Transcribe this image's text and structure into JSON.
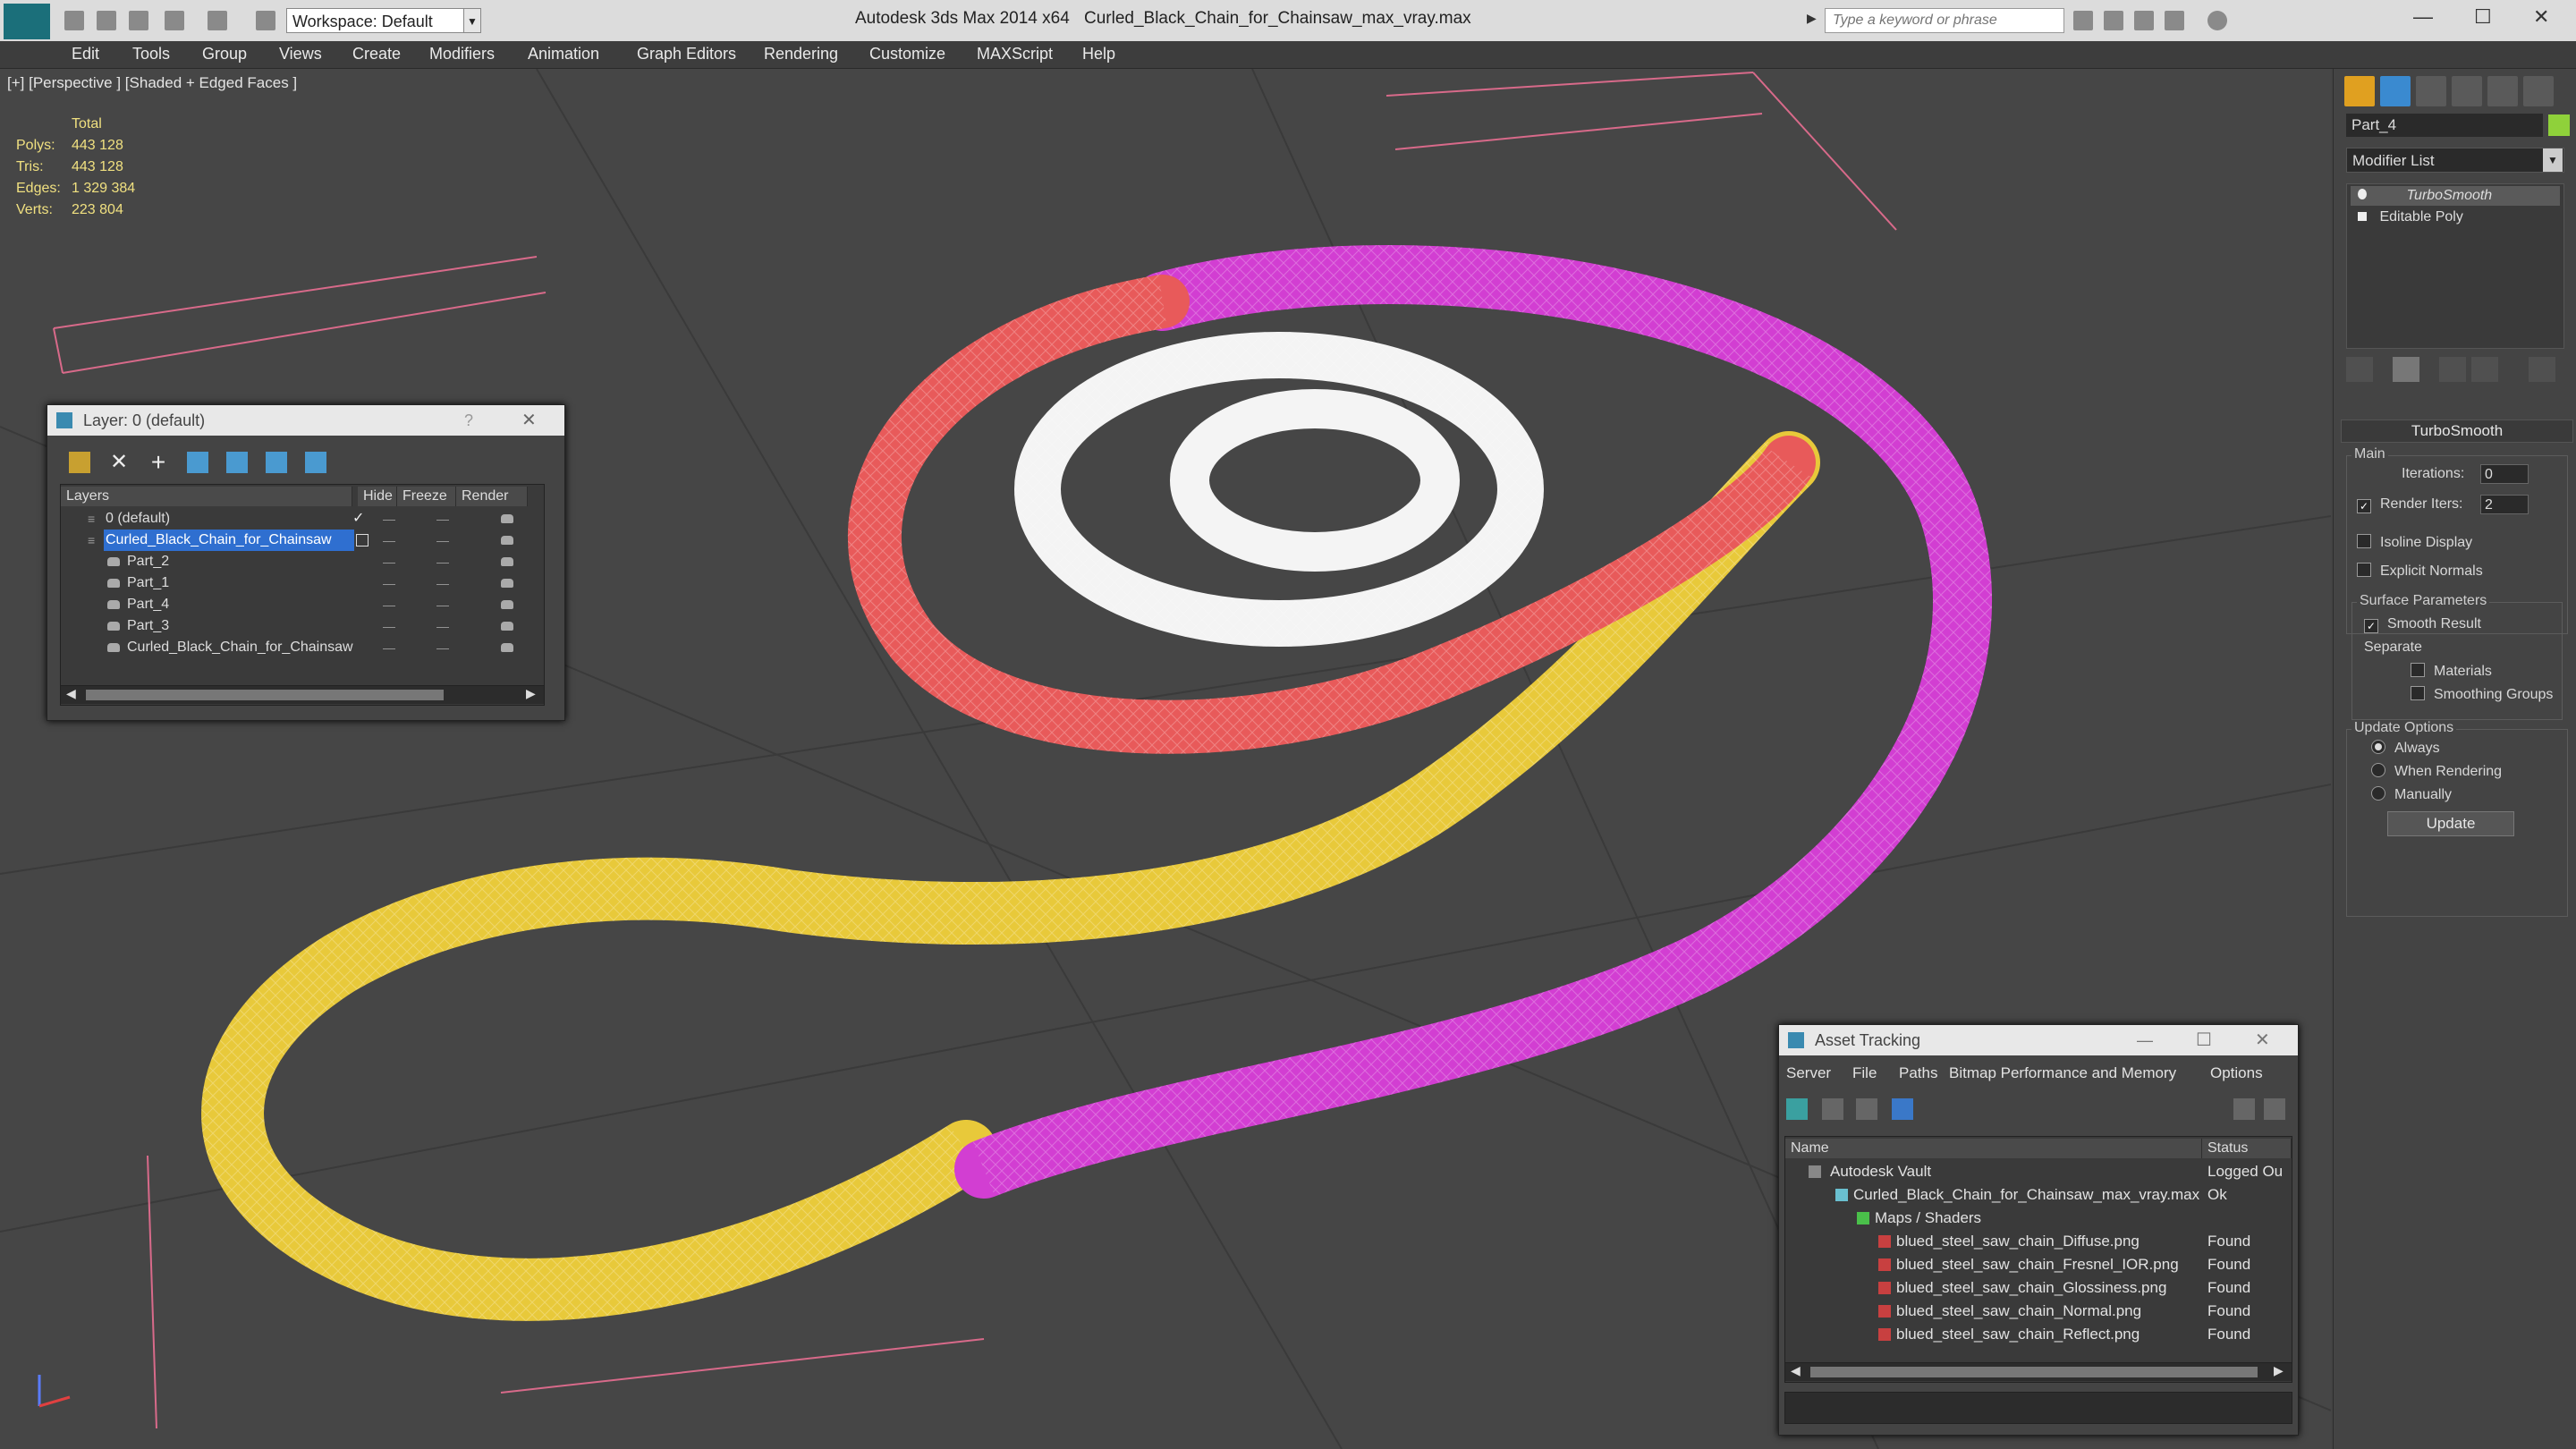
{
  "app": {
    "title_app": "Autodesk 3ds Max  2014 x64",
    "title_file": "Curled_Black_Chain_for_Chainsaw_max_vray.max",
    "workspace_label": "Workspace: Default",
    "search_placeholder": "Type a keyword or phrase"
  },
  "menu": [
    "Edit",
    "Tools",
    "Group",
    "Views",
    "Create",
    "Modifiers",
    "Animation",
    "Graph Editors",
    "Rendering",
    "Customize",
    "MAXScript",
    "Help"
  ],
  "viewport": {
    "label": "[+] [Perspective ] [Shaded + Edged Faces ]",
    "stats": {
      "header": "Total",
      "polys_label": "Polys:",
      "polys": "443 128",
      "tris_label": "Tris:",
      "tris": "443 128",
      "edges_label": "Edges:",
      "edges": "1 329 384",
      "verts_label": "Verts:",
      "verts": "223 804"
    },
    "colors": {
      "white_chain": "#ffffff",
      "red_chain": "#e85a5a",
      "magenta_chain": "#d23ed2",
      "yellow_chain": "#e8c93a",
      "grey_link": "#b8b8b8"
    }
  },
  "command_panel": {
    "object_name": "Part_4",
    "object_color": "#8fd13a",
    "modifier_list": "Modifier List",
    "stack": [
      "TurboSmooth",
      "Editable Poly"
    ],
    "rollout_title": "TurboSmooth",
    "main_group": "Main",
    "iterations_label": "Iterations:",
    "iterations": "0",
    "render_iters_label": "Render Iters:",
    "render_iters": "2",
    "isoline_label": "Isoline Display",
    "explicit_normals_label": "Explicit Normals",
    "surface_group": "Surface Parameters",
    "smooth_result_label": "Smooth Result",
    "separate_label": "Separate",
    "materials_label": "Materials",
    "smoothing_groups_label": "Smoothing Groups",
    "update_group": "Update Options",
    "always_label": "Always",
    "when_rendering_label": "When Rendering",
    "manually_label": "Manually",
    "update_button": "Update"
  },
  "layer_dialog": {
    "title": "Layer: 0 (default)",
    "help": "?",
    "columns": [
      "Layers",
      "Hide",
      "Freeze",
      "Render"
    ],
    "rows": [
      "0 (default)",
      "Curled_Black_Chain_for_Chainsaw",
      "Part_2",
      "Part_1",
      "Part_4",
      "Part_3",
      "Curled_Black_Chain_for_Chainsaw"
    ]
  },
  "asset_dialog": {
    "title": "Asset Tracking",
    "menu": [
      "Server",
      "File",
      "Paths",
      "Bitmap Performance and Memory",
      "Options"
    ],
    "columns": [
      "Name",
      "Status"
    ],
    "rows": [
      {
        "name": "Autodesk Vault",
        "status": "Logged Ou"
      },
      {
        "name": "Curled_Black_Chain_for_Chainsaw_max_vray.max",
        "status": "Ok"
      },
      {
        "name": "Maps / Shaders",
        "status": ""
      },
      {
        "name": "blued_steel_saw_chain_Diffuse.png",
        "status": "Found"
      },
      {
        "name": "blued_steel_saw_chain_Fresnel_IOR.png",
        "status": "Found"
      },
      {
        "name": "blued_steel_saw_chain_Glossiness.png",
        "status": "Found"
      },
      {
        "name": "blued_steel_saw_chain_Normal.png",
        "status": "Found"
      },
      {
        "name": "blued_steel_saw_chain_Reflect.png",
        "status": "Found"
      }
    ]
  }
}
